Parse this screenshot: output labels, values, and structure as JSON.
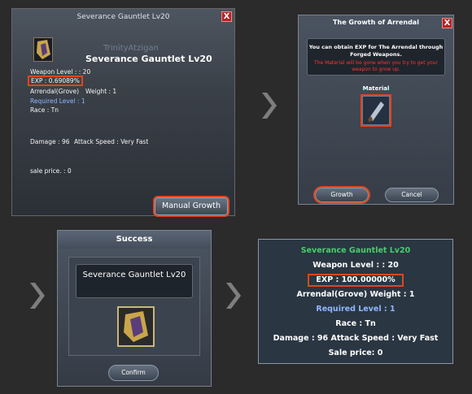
{
  "panel1": {
    "title": "Severance Gauntlet Lv20",
    "ghost_name": "TrinityAtzigan",
    "item_name": "Severance Gauntlet Lv20",
    "weapon_level": "Weapon Level : : 20",
    "exp": "EXP : 0.69089%",
    "arrendal": "Arrendal(Grove)",
    "weight": "Weight : 1",
    "required_level": "Required Level : 1",
    "race": "Race : Tn",
    "damage": "Damage : 96",
    "attack_speed": "Attack Speed : Very Fast",
    "sale_price": "sale price. : 0",
    "button": "Manual Growth",
    "close": "X"
  },
  "panel2": {
    "title": "The Growth of Arrendal",
    "close": "X",
    "message": "You can obtain EXP for The Arrendal through Forged Weapons.",
    "warning": "The Material will be gone when you try to get your weapon to grow up.",
    "material_label": "Material",
    "growth_button": "Growth",
    "cancel_button": "Cancel"
  },
  "panel3": {
    "title": "Success",
    "item_name": "Severance Gauntlet Lv20",
    "confirm_button": "Confirm"
  },
  "panel4": {
    "item_name": "Severance Gauntlet Lv20",
    "weapon_level": "Weapon Level : : 20",
    "exp": "EXP : 100.00000%",
    "arrendal_weight": "Arrendal(Grove)   Weight : 1",
    "required_level": "Required Level : 1",
    "race": "Race : Tn",
    "damage_speed": "Damage : 96   Attack Speed : Very Fast",
    "sale_price": "Sale price: 0"
  },
  "colors": {
    "highlight": "#e0451f",
    "green_name": "#45d06c",
    "blue_text": "#8fb7ff",
    "warning_red": "#ff3333"
  }
}
